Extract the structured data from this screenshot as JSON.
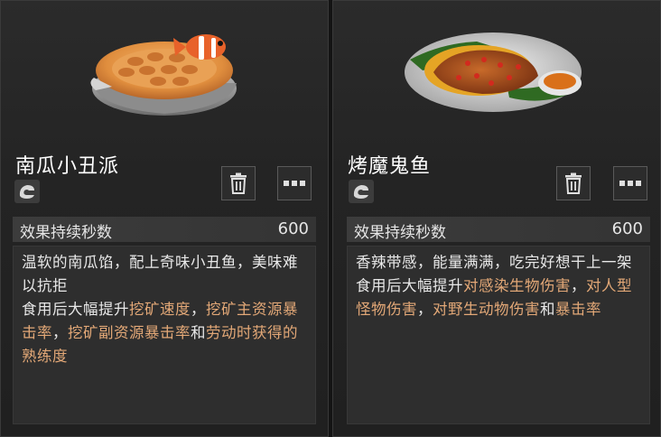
{
  "cards": [
    {
      "name": "南瓜小丑派",
      "food_icon": "pumpkin-clownfish-pie-icon",
      "category_icon": "food-category-icon",
      "duration_label": "效果持续秒数",
      "duration_value": "600",
      "flavor_text": "温软的南瓜馅，配上奇味小丑鱼，美味难以抗拒",
      "effect_prefix": "食用后大幅提升",
      "effect_parts": [
        {
          "text": "挖矿速度",
          "highlight": true
        },
        {
          "text": "，",
          "highlight": false
        },
        {
          "text": "挖矿主资源暴击率",
          "highlight": true
        },
        {
          "text": "，",
          "highlight": false
        },
        {
          "text": "挖矿副资源暴击率",
          "highlight": true
        },
        {
          "text": "和",
          "highlight": false
        },
        {
          "text": "劳动时获得的熟练度",
          "highlight": true
        }
      ]
    },
    {
      "name": "烤魔鬼鱼",
      "food_icon": "grilled-devilfish-icon",
      "category_icon": "food-category-icon",
      "duration_label": "效果持续秒数",
      "duration_value": "600",
      "flavor_text": "香辣带感，能量满满，吃完好想干上一架",
      "effect_prefix": "食用后大幅提升",
      "effect_parts": [
        {
          "text": "对感染生物伤害",
          "highlight": true
        },
        {
          "text": "，",
          "highlight": false
        },
        {
          "text": "对人型怪物伤害",
          "highlight": true
        },
        {
          "text": "，",
          "highlight": false
        },
        {
          "text": "对野生动物伤害",
          "highlight": true
        },
        {
          "text": "和",
          "highlight": false
        },
        {
          "text": "暴击率",
          "highlight": true
        }
      ]
    }
  ],
  "colors": {
    "highlight": "#e3a877",
    "text": "#e8e8e8",
    "panel": "#2b2b2b"
  },
  "button_icons": {
    "delete": "trash-icon",
    "more": "more-dots-icon"
  }
}
